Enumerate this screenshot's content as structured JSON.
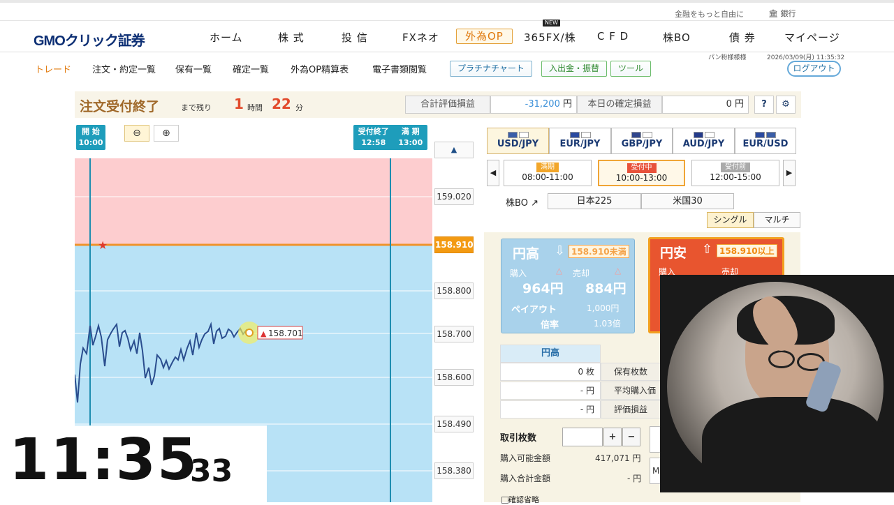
{
  "util": {
    "tagline": "金融をもっと自由に",
    "bank": "銀行"
  },
  "header": {
    "logo": "GMOクリック証券",
    "nav": [
      "ホーム",
      "株 式",
      "投 信",
      "FXネオ",
      "外為OP",
      "365FX/株",
      "C F D",
      "株BO",
      "債 券",
      "マイページ"
    ],
    "active": "外為OP",
    "new_badge": "NEW"
  },
  "subnav": {
    "items": [
      "トレード",
      "注文・約定一覧",
      "保有一覧",
      "確定一覧",
      "外為OP精算表",
      "電子書類閲覧"
    ],
    "buttons": [
      "プラチナチャート",
      "入出金・振替",
      "ツール"
    ],
    "user": "パン粉様様様",
    "datetime": "2026/03/09(月) 11:35:32",
    "logout": "ログアウト"
  },
  "status": {
    "title": "注文受付終了",
    "remaining": "まで残り",
    "hours": "1",
    "hours_unit": "時間",
    "minutes": "22",
    "minutes_unit": "分",
    "total_pl_label": "合計評価損益",
    "total_pl_value": "-31,200",
    "yen": "円",
    "today_label": "本日の確定損益",
    "today_value": "0",
    "help_icon": "?",
    "settings_icon": "gear-icon"
  },
  "chart": {
    "start_label": "開 始",
    "start_time": "10:00",
    "end_label": "受付終了",
    "end_time": "12:58",
    "expire_label": "満 期",
    "expire_time": "13:00",
    "price_levels": [
      "159.020",
      "158.910",
      "158.800",
      "158.700",
      "158.600",
      "158.490",
      "158.380"
    ],
    "strike": "158.910",
    "current": "158.701",
    "zoom_out": "zoom-out-icon",
    "zoom_in": "zoom-in-icon"
  },
  "currencies": [
    "USD/JPY",
    "EUR/JPY",
    "GBP/JPY",
    "AUD/JPY",
    "EUR/USD"
  ],
  "sessions": [
    {
      "status": "満期",
      "time": "08:00-11:00"
    },
    {
      "status": "受付中",
      "time": "10:00-13:00"
    },
    {
      "status": "受付前",
      "time": "12:00-15:00"
    }
  ],
  "kabubo": {
    "label": "株BO",
    "markets": [
      "日本225",
      "米国30"
    ]
  },
  "modes": [
    "シングル",
    "マルチ"
  ],
  "card_low": {
    "title": "円高",
    "strike": "158.910未満",
    "buy": "購入",
    "sell": "売却",
    "buy_price": "964円",
    "sell_price": "884円",
    "payout_label": "ペイアウト",
    "payout": "1,000円",
    "rate_label": "倍率",
    "rate": "1.03倍"
  },
  "card_high": {
    "title": "円安",
    "strike": "158.910以上",
    "buy": "購入",
    "sell": "売却"
  },
  "positions": {
    "header": "円高",
    "rows": [
      {
        "value": "0 枚",
        "label": "保有枚数"
      },
      {
        "value": "- 円",
        "label": "平均購入価"
      },
      {
        "value": "- 円",
        "label": "評価損益"
      }
    ]
  },
  "order": {
    "qty_label": "取引枚数",
    "plus": "+",
    "minus": "−",
    "avail_label": "購入可能金額",
    "avail_value": "417,071 円",
    "total_label": "購入合計金額",
    "total_value": "- 円",
    "confirm_skip": "確認省略"
  },
  "clock": {
    "hm": "11:35",
    "ss": "33"
  }
}
